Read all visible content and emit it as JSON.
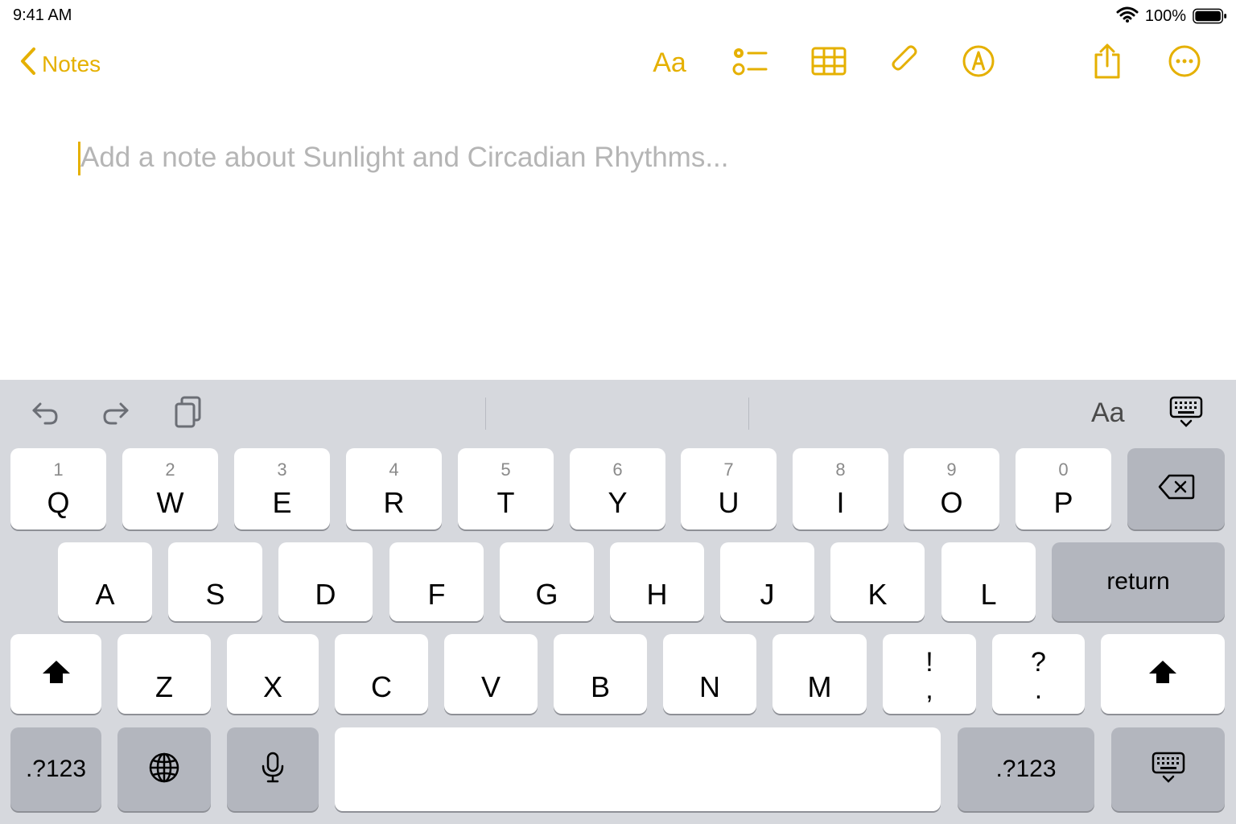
{
  "status_bar": {
    "time": "9:41 AM",
    "battery_percent": "100%",
    "battery_level": 1.0
  },
  "nav": {
    "back_label": "Notes",
    "format_label": "Aa",
    "accent_color": "#E5B000"
  },
  "note": {
    "placeholder": "Add a note about Sunlight and Circadian Rhythms..."
  },
  "keyboard": {
    "assist_format_label": "Aa",
    "row1": [
      {
        "num": "1",
        "letter": "Q"
      },
      {
        "num": "2",
        "letter": "W"
      },
      {
        "num": "3",
        "letter": "E"
      },
      {
        "num": "4",
        "letter": "R"
      },
      {
        "num": "5",
        "letter": "T"
      },
      {
        "num": "6",
        "letter": "Y"
      },
      {
        "num": "7",
        "letter": "U"
      },
      {
        "num": "8",
        "letter": "I"
      },
      {
        "num": "9",
        "letter": "O"
      },
      {
        "num": "0",
        "letter": "P"
      }
    ],
    "row2": [
      "A",
      "S",
      "D",
      "F",
      "G",
      "H",
      "J",
      "K",
      "L"
    ],
    "return_label": "return",
    "row3": [
      "Z",
      "X",
      "C",
      "V",
      "B",
      "N",
      "M"
    ],
    "punct1": {
      "top": "!",
      "bottom": ","
    },
    "punct2": {
      "top": "?",
      "bottom": "."
    },
    "numbers_label_left": ".?123",
    "numbers_label_right": ".?123"
  }
}
